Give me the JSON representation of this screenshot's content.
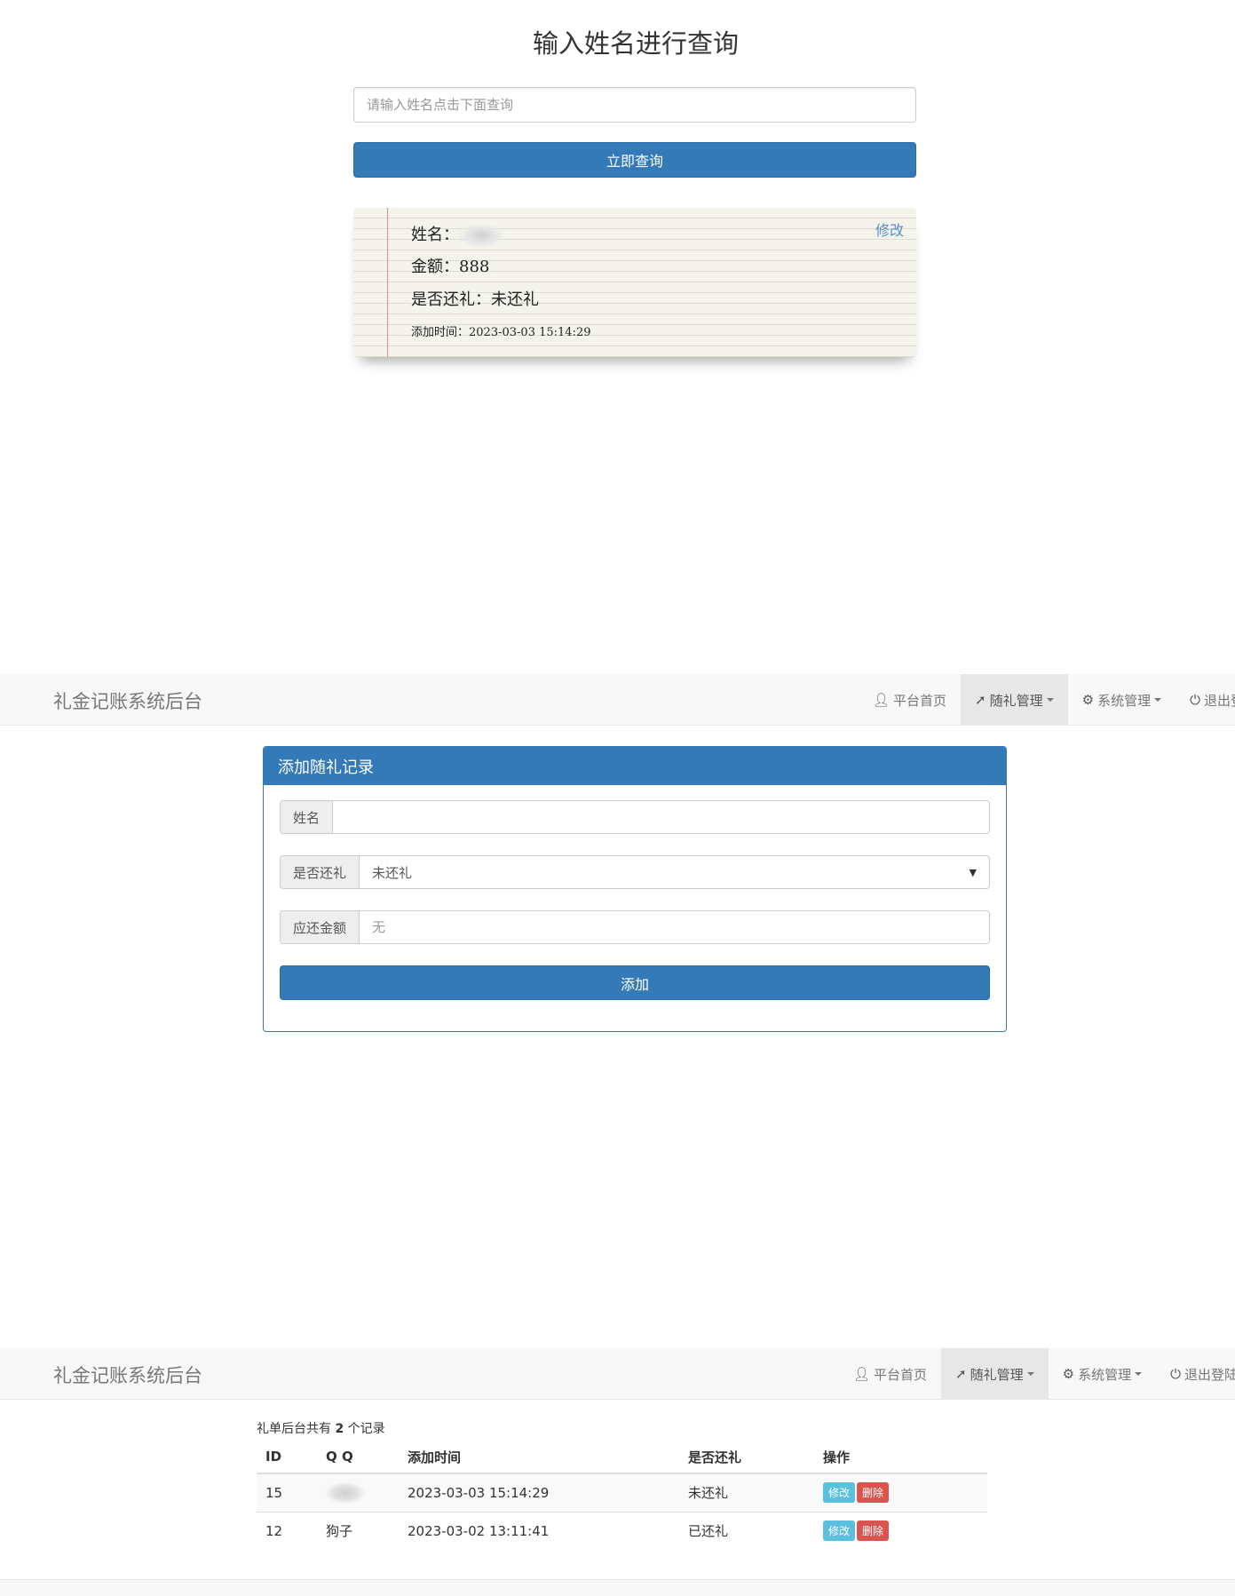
{
  "query": {
    "title": "输入姓名进行查询",
    "placeholder": "请输入姓名点击下面查询",
    "button": "立即查询"
  },
  "note": {
    "name_label": "姓名：",
    "amount_label": "金额：",
    "amount": "888",
    "returned_label": "是否还礼：",
    "returned": "未还礼",
    "time_label": "添加时间：",
    "time": "2023-03-03 15:14:29",
    "edit": "修改"
  },
  "nav": {
    "brand": "礼金记账系统后台",
    "home": "平台首页",
    "gift": "随礼管理",
    "system": "系统管理",
    "logout": "退出登陆"
  },
  "form": {
    "heading": "添加随礼记录",
    "name_label": "姓名",
    "returned_label": "是否还礼",
    "returned_value": "未还礼",
    "amount_label": "应还金额",
    "amount_placeholder": "无",
    "submit": "添加"
  },
  "list": {
    "summary_prefix": "礼单后台共有 ",
    "count": "2",
    "summary_suffix": " 个记录",
    "headers": [
      "ID",
      "Q Q",
      "添加时间",
      "是否还礼",
      "操作"
    ],
    "rows": [
      {
        "id": "15",
        "qq": "",
        "time": "2023-03-03 15:14:29",
        "returned": "未还礼",
        "edit": "修改",
        "delete": "删除"
      },
      {
        "id": "12",
        "qq": "狗子",
        "time": "2023-03-02 13:11:41",
        "returned": "已还礼",
        "edit": "修改",
        "delete": "删除"
      }
    ]
  },
  "colors": {
    "primary": "#337ab7",
    "info": "#5bc0de",
    "danger": "#d9534f",
    "navbar_bg": "#f8f8f8"
  },
  "icons": {
    "home": "user-icon",
    "gift": "pin-icon",
    "system": "gear-icon",
    "logout": "power-icon"
  }
}
